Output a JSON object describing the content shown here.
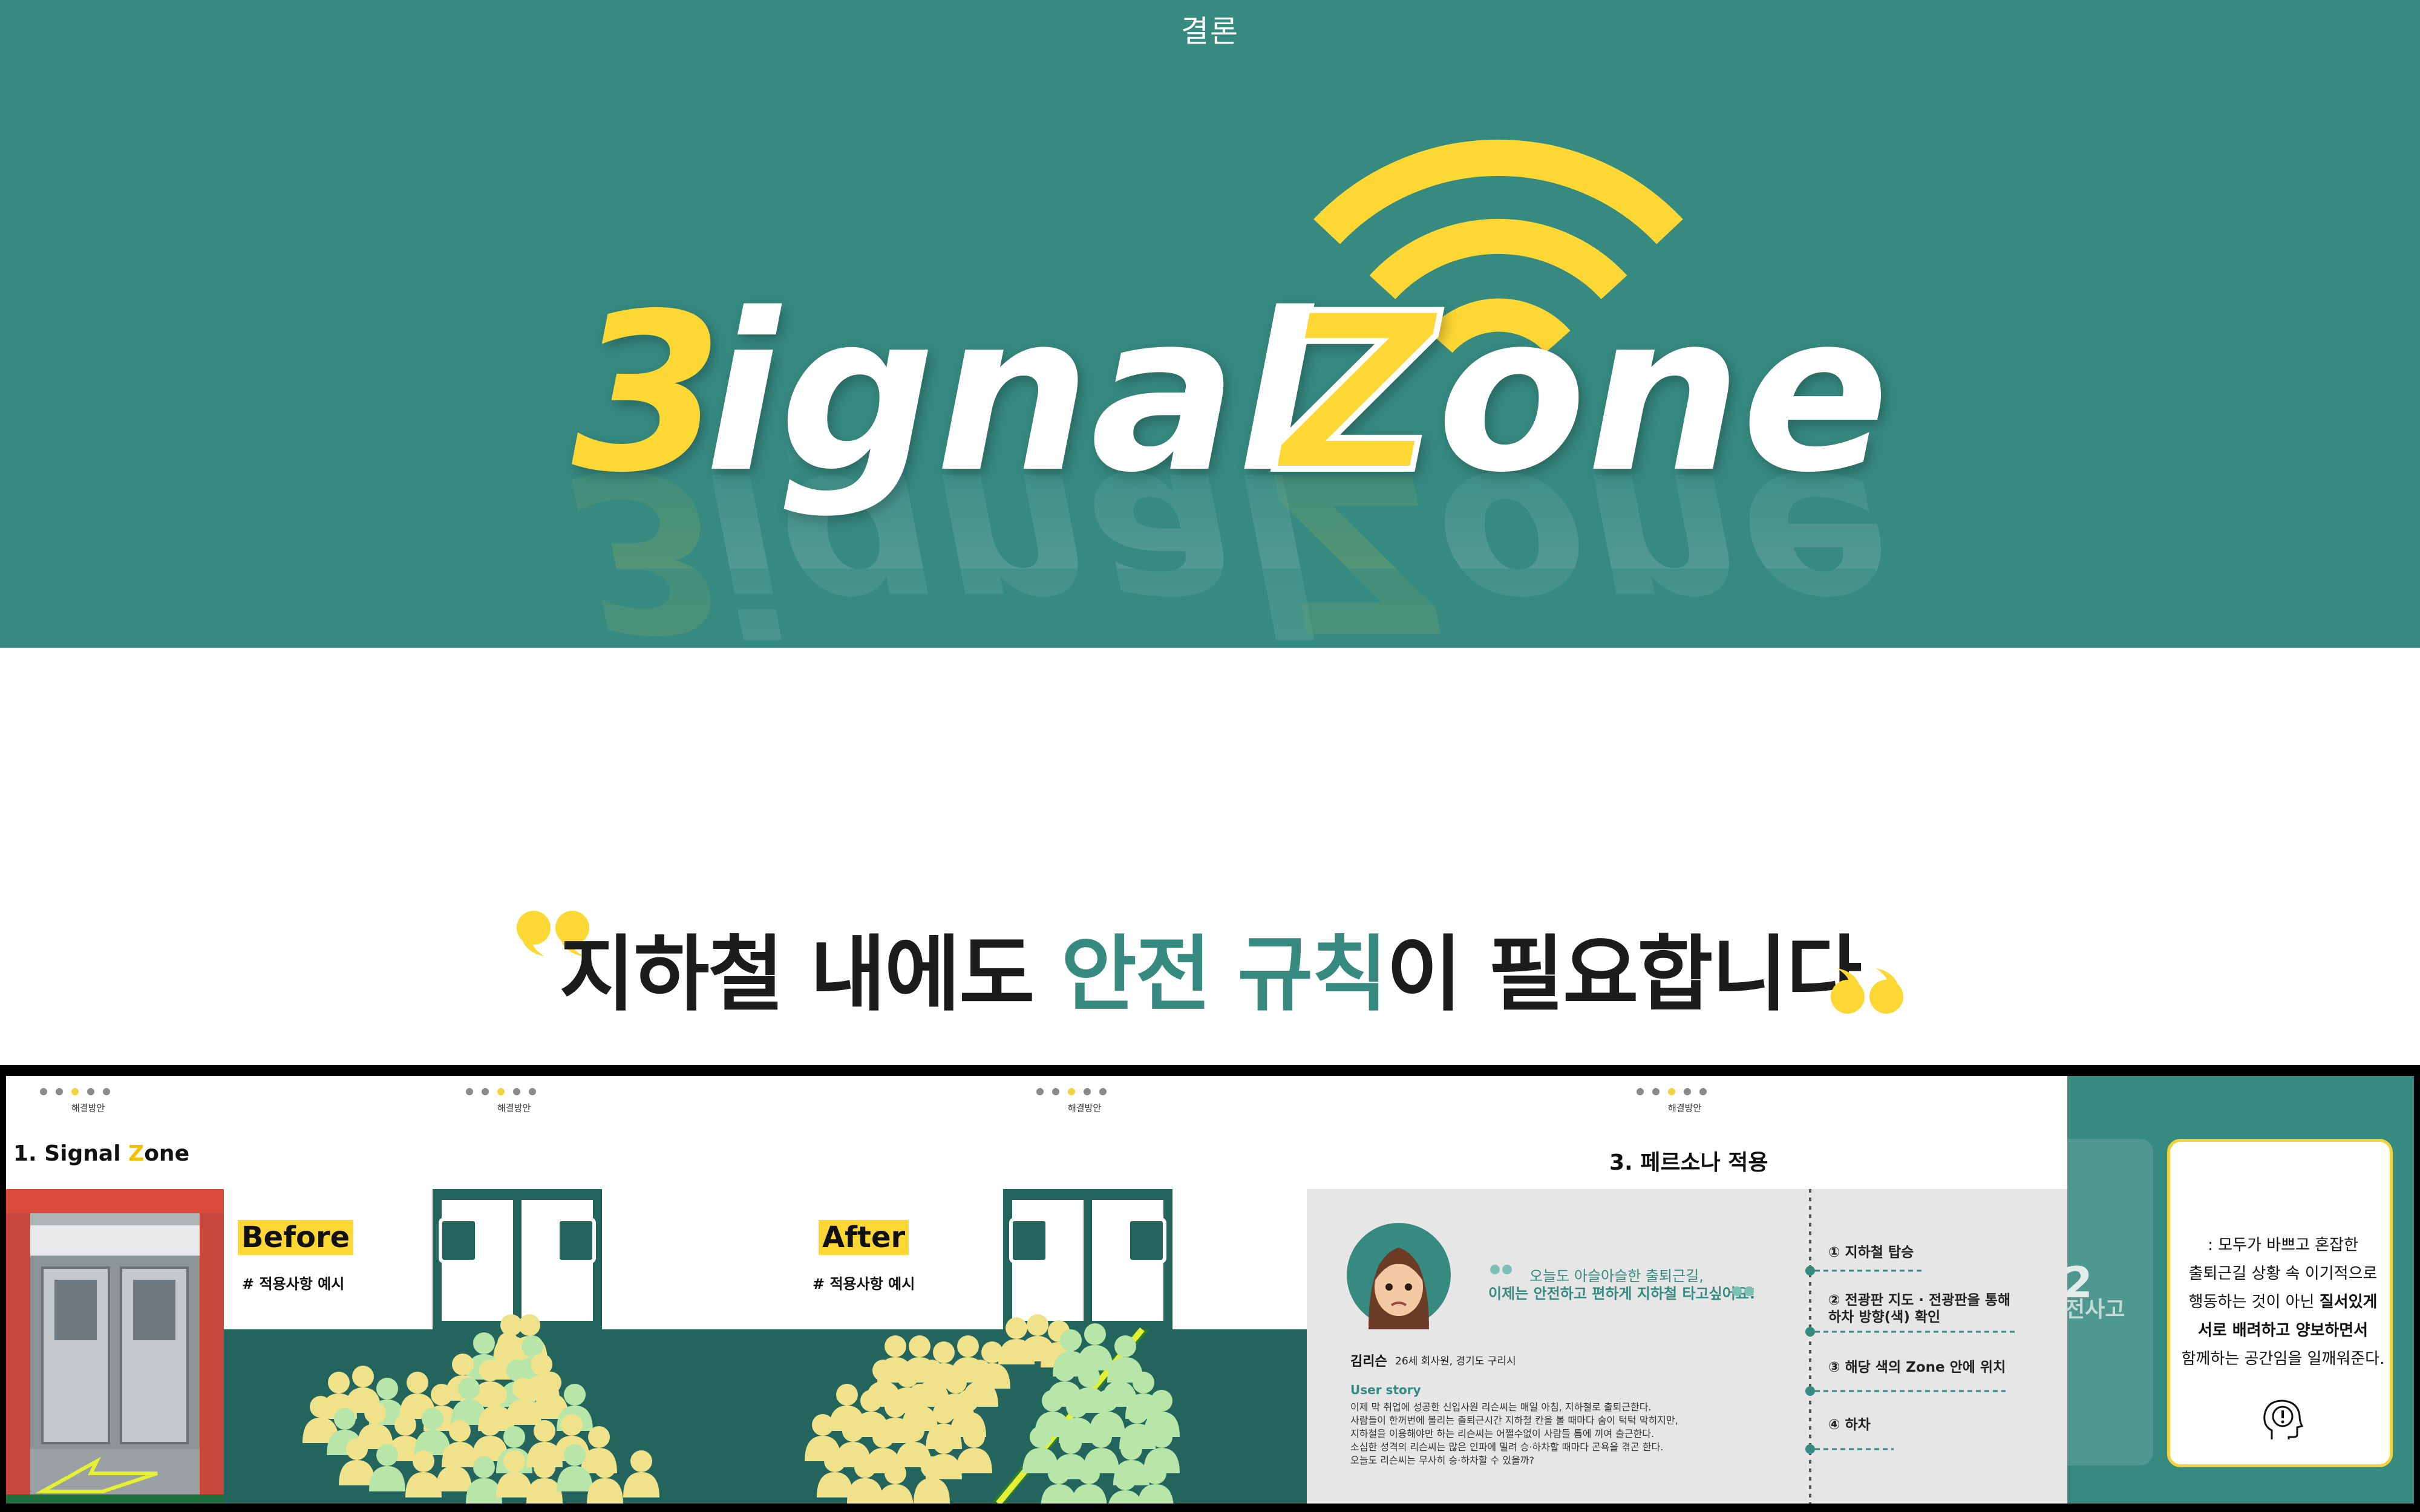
{
  "hero": {
    "section_title": "결론",
    "logo_part1": "3",
    "logo_part2": "ignal",
    "logo_part3": "Z",
    "logo_part4": "one",
    "signal_icon": "wifi-signal-icon"
  },
  "quote": {
    "text_before": "지하철 내에도 ",
    "text_highlight": "안전 규칙",
    "text_after": "이 필요합니다",
    "open_quote_icon": "open-quote-icon",
    "close_quote_icon": "close-quote-icon"
  },
  "slides": {
    "slide1": {
      "tab_label": "해결방안",
      "title_prefix": "1. Signal ",
      "title_z": "Z",
      "title_suffix": "one"
    },
    "slide2": {
      "tab_label": "해결방안",
      "label": "Before",
      "sub": "# 적용사항 예시"
    },
    "slide3": {
      "tab_label": "해결방안",
      "label": "After",
      "sub": "# 적용사항 예시"
    },
    "slide4": {
      "tab_label": "해결방안",
      "title": "3. 페르소나 적용",
      "quote1": "오늘도 아슬아슬한 출퇴근길,",
      "quote2": "이제는 안전하고 편하게 지하철 타고싶어요!",
      "name": "김리슨",
      "meta": "26세 회사원, 경기도 구리시",
      "story_heading": "User story",
      "story_lines": [
        "이제 막 취업에 성공한 신입사원 리슨씨는 매일 아침, 지하철로 출퇴근한다.",
        "사람들이 한꺼번에 몰리는 출퇴근시간 지하철 칸을 볼 때마다 숨이 턱턱 막히지만,",
        "지하철을 이용해야만 하는 리슨씨는 어쩔수없이 사람들 틈에 끼여 출근한다.",
        "소심한 성격의 리슨씨는 많은 인파에 밀려 승·하차할 때마다 곤욕을 겪곤 한다.",
        "오늘도 리슨씨는 무사히 승·하차할 수 있을까?"
      ],
      "steps": [
        "① 지하철 탑승",
        "② 전광판 지도 · 전광판을 통해",
        "하차 방향(색) 확인",
        "③ 해당 색의 Zone 안에 위치",
        "④ 하차"
      ]
    },
    "summary": {
      "ghost_text": "전사고",
      "ghost_num": "2",
      "line1": ": 모두가 바쁘고 혼잡한",
      "line2": "출퇴근길 상황 속 이기적으로",
      "line3_a": "행동하는 것이 아닌 ",
      "line3_b": "질서있게",
      "line4": "서로 배려하고 양보하면서",
      "line5": "함께하는 공간임을 일깨워준다.",
      "icon": "head-exclamation-icon"
    }
  },
  "colors": {
    "teal": "#368a80",
    "yellow": "#fdd835",
    "dark_teal": "#23655d",
    "green_zone": "#2e7d32"
  }
}
